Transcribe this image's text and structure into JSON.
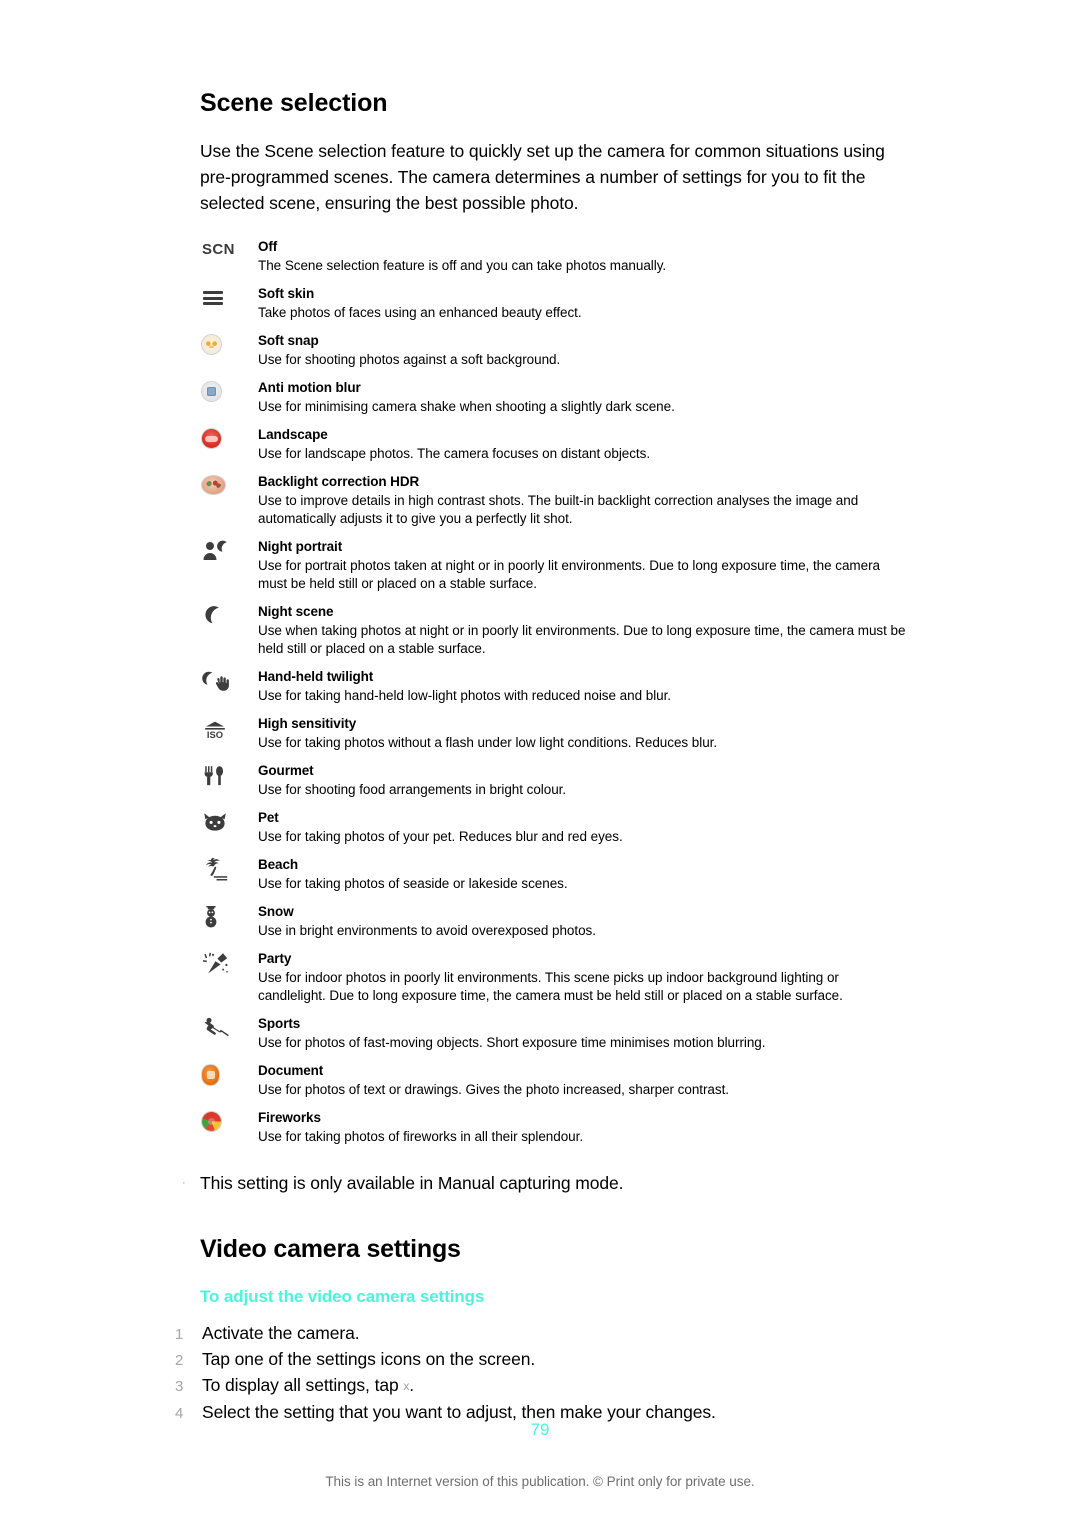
{
  "section": {
    "heading": "Scene selection",
    "intro": "Use the Scene selection feature to quickly set up the camera for common situations using pre-programmed scenes. The camera determines a number of settings for you to fit the selected scene, ensuring the best possible photo."
  },
  "scenes": [
    {
      "icon": "scn-text-icon",
      "title": "Off",
      "desc": "The Scene selection feature is off and you can take photos manually."
    },
    {
      "icon": "soft-skin-bars-icon",
      "title": "Soft skin",
      "desc": "Take photos of faces using an enhanced beauty effect."
    },
    {
      "icon": "soft-snap-icon",
      "title": "Soft snap",
      "desc": "Use for shooting photos against a soft background."
    },
    {
      "icon": "anti-motion-blur-icon",
      "title": "Anti motion blur",
      "desc": "Use for minimising camera shake when shooting a slightly dark scene."
    },
    {
      "icon": "landscape-icon",
      "title": "Landscape",
      "desc": "Use for landscape photos. The camera focuses on distant objects."
    },
    {
      "icon": "backlight-hdr-icon",
      "title": "Backlight correction HDR",
      "desc": "Use to improve details in high contrast shots. The built-in backlight correction analyses the image and automatically adjusts it to give you a perfectly lit shot."
    },
    {
      "icon": "night-portrait-icon",
      "title": "Night portrait",
      "desc": "Use for portrait photos taken at night or in poorly lit environments. Due to long exposure time, the camera must be held still or placed on a stable surface."
    },
    {
      "icon": "night-scene-moon-icon",
      "title": "Night scene",
      "desc": "Use when taking photos at night or in poorly lit environments. Due to long exposure time, the camera must be held still or placed on a stable surface."
    },
    {
      "icon": "hand-held-twilight-icon",
      "title": "Hand-held twilight",
      "desc": "Use for taking hand-held low-light photos with reduced noise and blur."
    },
    {
      "icon": "iso-high-sensitivity-icon",
      "title": "High sensitivity",
      "desc": "Use for taking photos without a flash under low light conditions. Reduces blur."
    },
    {
      "icon": "gourmet-cutlery-icon",
      "title": "Gourmet",
      "desc": "Use for shooting food arrangements in bright colour."
    },
    {
      "icon": "pet-cat-face-icon",
      "title": "Pet",
      "desc": "Use for taking photos of your pet. Reduces blur and red eyes."
    },
    {
      "icon": "beach-palm-tree-icon",
      "title": "Beach",
      "desc": "Use for taking photos of seaside or lakeside scenes."
    },
    {
      "icon": "snow-snowman-icon",
      "title": "Snow",
      "desc": "Use in bright environments to avoid overexposed photos."
    },
    {
      "icon": "party-popper-icon",
      "title": "Party",
      "desc": "Use for indoor photos in poorly lit environments. This scene picks up indoor background lighting or candlelight. Due to long exposure time, the camera must be held still or placed on a stable surface."
    },
    {
      "icon": "sports-runner-icon",
      "title": "Sports",
      "desc": "Use for photos of fast-moving objects. Short exposure time minimises motion blurring."
    },
    {
      "icon": "document-icon",
      "title": "Document",
      "desc": "Use for photos of text or drawings. Gives the photo increased, sharper contrast."
    },
    {
      "icon": "fireworks-icon",
      "title": "Fireworks",
      "desc": "Use for taking photos of fireworks in all their splendour."
    }
  ],
  "scn_label": "SCN",
  "note": {
    "bullet": "·",
    "text": "This setting is only available in Manual capturing mode."
  },
  "video_section": {
    "heading": "Video camera settings",
    "subheading": "To adjust the video camera settings",
    "steps": [
      {
        "num": "1",
        "text": "Activate the camera."
      },
      {
        "num": "2",
        "text": "Tap one of the settings icons on the screen."
      },
      {
        "num": "3",
        "text_before": "To display all settings, tap ",
        "glyph": "settings-glyph",
        "text_after": "."
      },
      {
        "num": "4",
        "text": "Select the setting that you want to adjust, then make your changes."
      }
    ]
  },
  "footer": {
    "page_number": "79",
    "note": "This is an Internet version of this publication. © Print only for private use."
  },
  "colors": {
    "accent_cyan": "#4ef2dc",
    "body_text": "#000000",
    "muted": "#6e6e6e",
    "step_number": "#a6a6a6"
  }
}
